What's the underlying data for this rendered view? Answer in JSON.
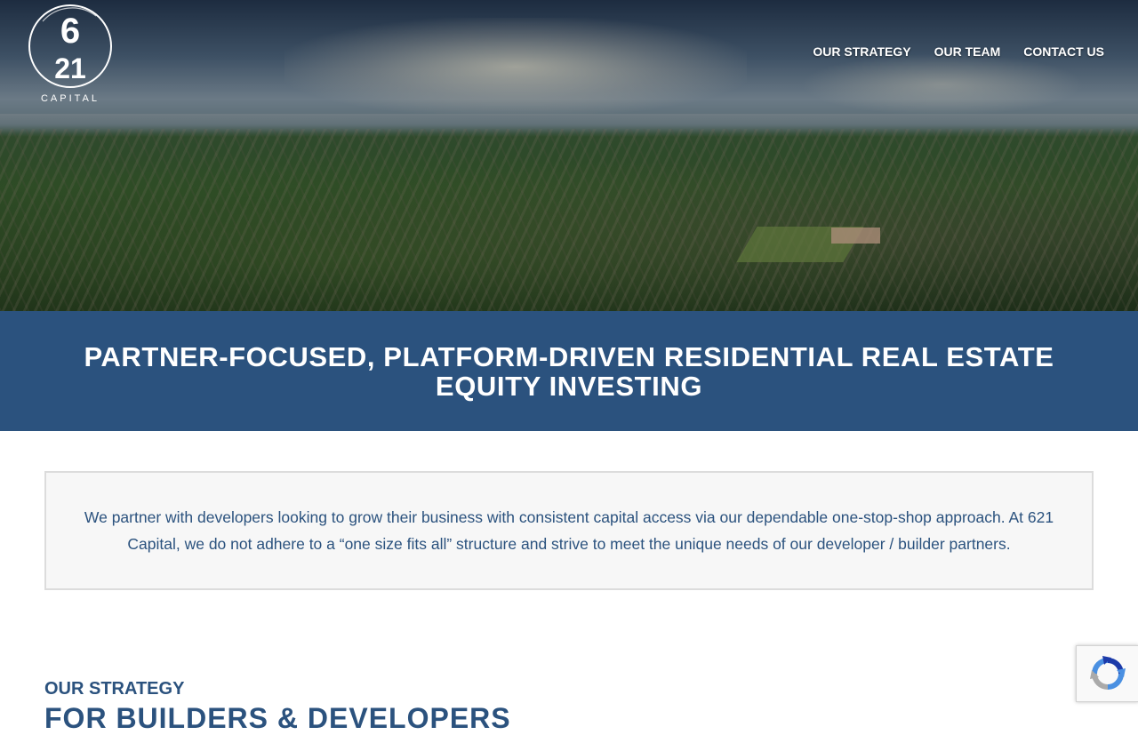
{
  "logo": {
    "top_number": "6",
    "bottom_number": "21",
    "caption": "CAPITAL"
  },
  "nav": {
    "items": [
      {
        "label": "OUR STRATEGY"
      },
      {
        "label": "OUR TEAM"
      },
      {
        "label": "CONTACT US"
      }
    ]
  },
  "banner": {
    "headline": "PARTNER-FOCUSED, PLATFORM-DRIVEN RESIDENTIAL REAL ESTATE EQUITY INVESTING"
  },
  "intro": {
    "text": "We partner with developers looking to grow their business with consistent capital access via our dependable one-stop-shop approach. At 621 Capital, we do not adhere to a “one size fits all” structure and strive to meet the unique needs of our developer / builder partners."
  },
  "strategy": {
    "label": "OUR STRATEGY",
    "heading": "FOR BUILDERS & DEVELOPERS"
  },
  "recaptcha": {
    "icon": "recaptcha-icon"
  },
  "colors": {
    "brand_blue": "#2b527e",
    "box_background": "#f7f7f7",
    "white": "#ffffff"
  }
}
